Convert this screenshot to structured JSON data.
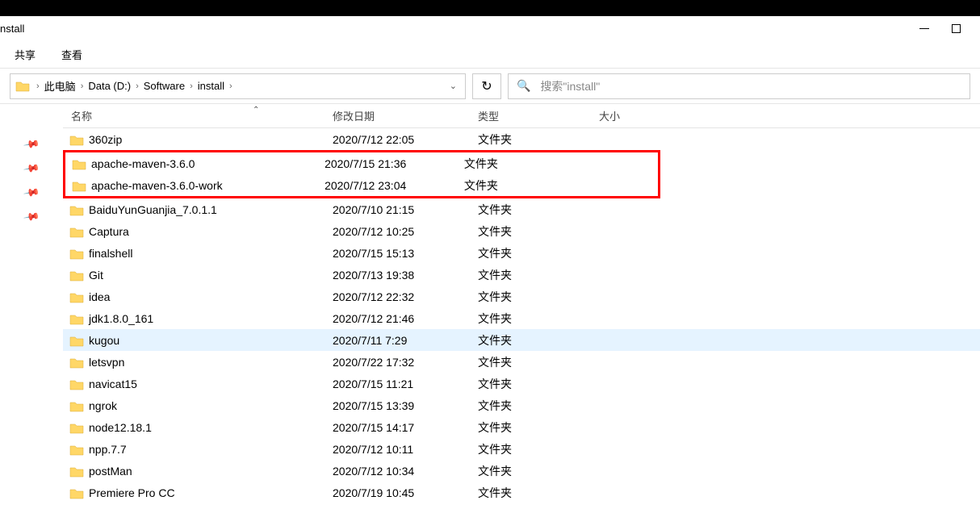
{
  "window": {
    "title": "nstall",
    "min": "—",
    "max": "☐"
  },
  "ribbon": {
    "share": "共享",
    "view": "查看"
  },
  "breadcrumb": {
    "pc": "此电脑",
    "drive": "Data (D:)",
    "software": "Software",
    "install": "install"
  },
  "search": {
    "placeholder": "搜索\"install\""
  },
  "columns": {
    "name": "名称",
    "date": "修改日期",
    "type": "类型",
    "size": "大小"
  },
  "type_folder": "文件夹",
  "rows": [
    {
      "name": "360zip",
      "date": "2020/7/12 22:05",
      "type": "文件夹",
      "hl": false
    },
    {
      "name": "apache-maven-3.6.0",
      "date": "2020/7/15 21:36",
      "type": "文件夹",
      "hl": true
    },
    {
      "name": "apache-maven-3.6.0-work",
      "date": "2020/7/12 23:04",
      "type": "文件夹",
      "hl": true
    },
    {
      "name": "BaiduYunGuanjia_7.0.1.1",
      "date": "2020/7/10 21:15",
      "type": "文件夹",
      "hl": false
    },
    {
      "name": "Captura",
      "date": "2020/7/12 10:25",
      "type": "文件夹",
      "hl": false
    },
    {
      "name": "finalshell",
      "date": "2020/7/15 15:13",
      "type": "文件夹",
      "hl": false
    },
    {
      "name": "Git",
      "date": "2020/7/13 19:38",
      "type": "文件夹",
      "hl": false
    },
    {
      "name": "idea",
      "date": "2020/7/12 22:32",
      "type": "文件夹",
      "hl": false
    },
    {
      "name": "jdk1.8.0_161",
      "date": "2020/7/12 21:46",
      "type": "文件夹",
      "hl": false
    },
    {
      "name": "kugou",
      "date": "2020/7/11 7:29",
      "type": "文件夹",
      "hl": false,
      "hover": true
    },
    {
      "name": "letsvpn",
      "date": "2020/7/22 17:32",
      "type": "文件夹",
      "hl": false
    },
    {
      "name": "navicat15",
      "date": "2020/7/15 11:21",
      "type": "文件夹",
      "hl": false
    },
    {
      "name": "ngrok",
      "date": "2020/7/15 13:39",
      "type": "文件夹",
      "hl": false
    },
    {
      "name": "node12.18.1",
      "date": "2020/7/15 14:17",
      "type": "文件夹",
      "hl": false
    },
    {
      "name": "npp.7.7",
      "date": "2020/7/12 10:11",
      "type": "文件夹",
      "hl": false
    },
    {
      "name": "postMan",
      "date": "2020/7/12 10:34",
      "type": "文件夹",
      "hl": false
    },
    {
      "name": "Premiere Pro CC",
      "date": "2020/7/19 10:45",
      "type": "文件夹",
      "hl": false
    }
  ]
}
